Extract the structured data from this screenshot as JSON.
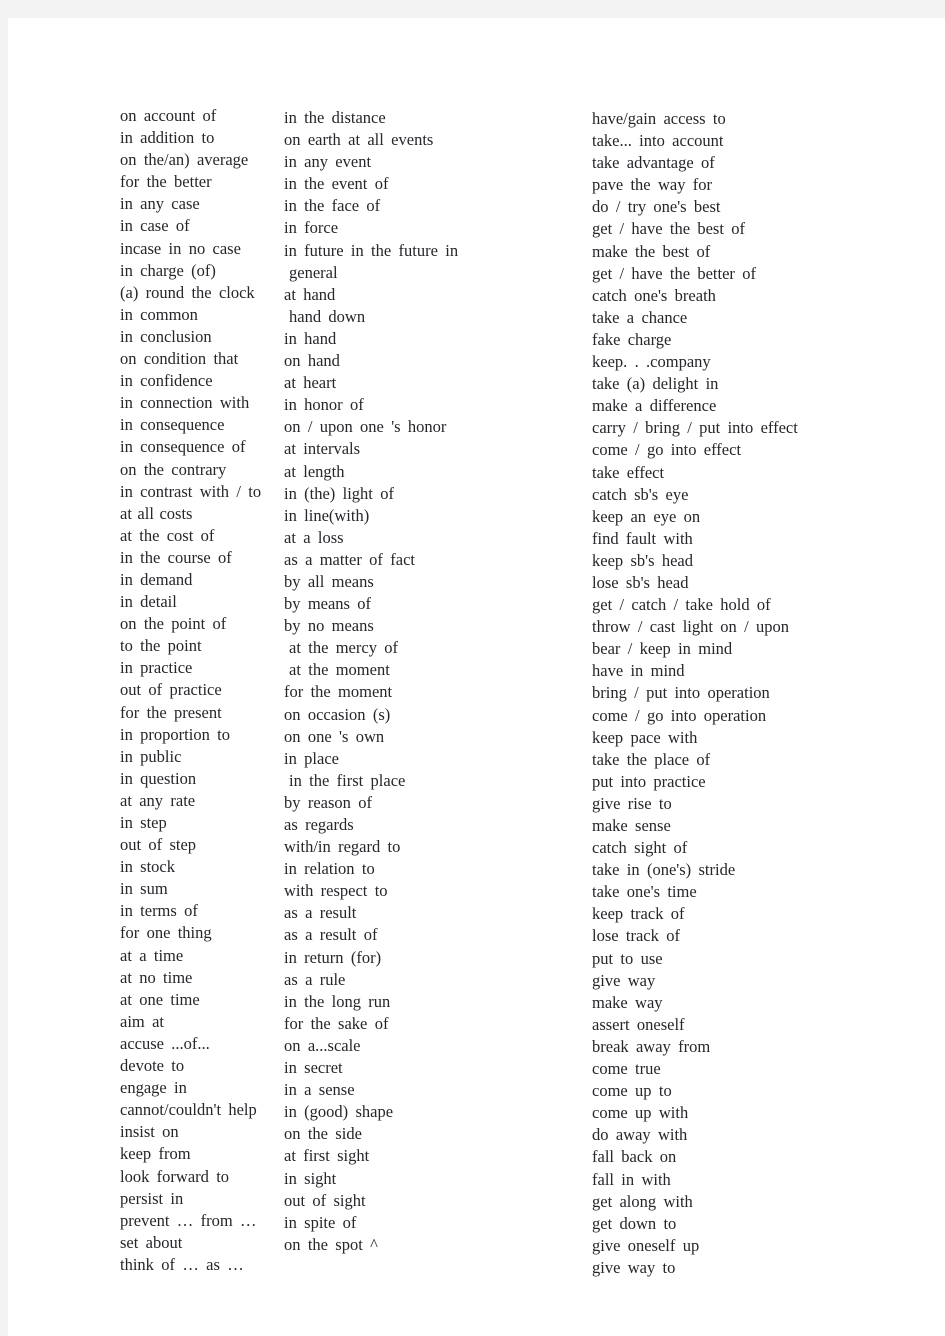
{
  "page": {
    "background_color": "#f3f3f3",
    "sheet_color": "#ffffff",
    "text_color": "#26262b"
  },
  "columns": [
    {
      "id": "column-1",
      "lines": [
        "on account of",
        "in addition to",
        "on the/an) average",
        "for the better",
        "in any case",
        "in case of",
        "incase in no case",
        "in charge (of)",
        "(a) round the clock",
        "in common",
        "in conclusion",
        "on condition that",
        "in confidence",
        "in connection with",
        "in consequence",
        "in consequence of",
        "on the contrary",
        "in contrast with / to",
        "at all costs",
        "at the cost of",
        "in the course of",
        "in demand",
        "in detail",
        "on the point of",
        "to the point",
        "in practice",
        "out of practice",
        "for the present",
        "in proportion to",
        "in public",
        "in question",
        "at any rate",
        "in step",
        "out of step",
        "in stock",
        "in sum",
        "in terms of",
        "for one thing",
        "at a time",
        "at no time",
        "at one time",
        "aim at",
        "accuse ...of...",
        "devote to",
        "engage in",
        "cannot/couldn't help",
        "insist on",
        "keep from",
        "look forward to",
        "persist in",
        "prevent … from …",
        "set about",
        "think of … as …"
      ]
    },
    {
      "id": "column-2",
      "lines": [
        "in the distance",
        "on earth at all events",
        "in any event",
        "in the event of",
        "in the face of",
        "in force",
        "in future in the future in",
        "general",
        "at hand",
        "hand down",
        "in hand",
        "on hand",
        "at heart",
        "in honor of",
        "on / upon one 's honor",
        "at intervals",
        "at length",
        "in (the) light of",
        "in line(with)",
        "at a loss",
        "as a matter of fact",
        "by all means",
        "by means of",
        "by no means",
        "at the mercy of",
        "at the moment",
        "for the moment",
        "on occasion (s)",
        "on one 's own",
        "in place",
        "in the first place",
        "by reason of",
        "as regards",
        "with/in regard to",
        "in relation to",
        "with respect to",
        "as a result",
        "as a result of",
        "in return (for)",
        "as a rule",
        "in the long run",
        "for the sake of",
        "on a...scale",
        "in secret",
        "in a sense",
        "in (good) shape",
        "on the side",
        "at first sight",
        "in sight",
        "out of sight",
        "in spite of",
        "on the spot ^"
      ]
    },
    {
      "id": "column-3",
      "lines": [
        "have/gain access to",
        "take... into account",
        "take advantage of",
        "pave the way for",
        "do / try one's best",
        "get / have the best of",
        "make the best of",
        "get / have the better of",
        "catch one's breath",
        "take a chance",
        "fake charge",
        "keep. . .company",
        "take (a) delight in",
        "make a difference",
        "carry / bring / put into effect",
        "come / go into effect",
        "take effect",
        "catch sb's eye",
        "keep an eye on",
        "find fault with",
        "keep sb's head",
        "lose sb's head",
        "get / catch / take hold of",
        "throw / cast light on / upon",
        "bear / keep in mind",
        "have in mind",
        "bring / put into operation",
        "come / go into operation",
        "keep pace with",
        "take the place of",
        "put into practice",
        "give rise to",
        "make sense",
        "catch sight of",
        "take in (one's) stride",
        "take one's time",
        "keep track of",
        "lose track of",
        "put to use",
        "give way",
        "make way",
        "assert oneself",
        "break away from",
        "come true",
        "come up to",
        "come up with",
        "do away with",
        "fall back on",
        "fall in with",
        "get along with",
        "get down to",
        "give oneself up",
        "give way to"
      ]
    }
  ]
}
